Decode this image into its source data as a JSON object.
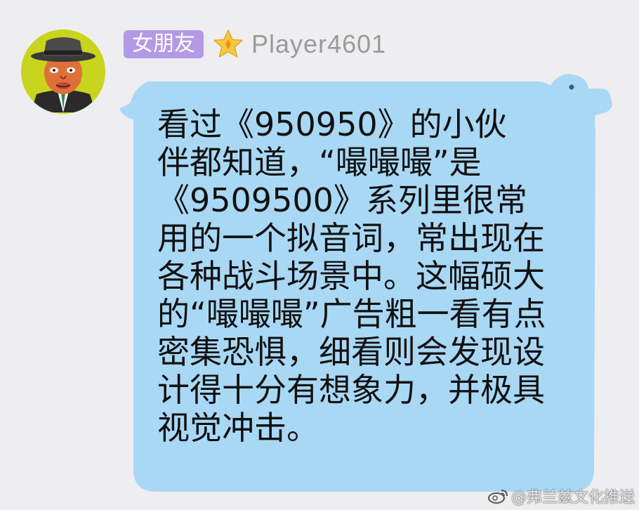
{
  "sender": {
    "tag": "女朋友",
    "name": "Player4601"
  },
  "message": {
    "text": "看过《950950》的小伙\n伴都知道，“嘬嘬嘬”是\n《9509500》系列里很常\n用的一个拟音词，常出现在\n各种战斗场景中。这幅硕大\n的“嘬嘬嘬”广告粗一看有点\n密集恐惧，细看则会发现设\n计得十分有想象力，并极具\n视觉冲击。"
  },
  "watermark": {
    "text": "@弗兰兹文化推送"
  },
  "icons": {
    "avatar": "avatar-cartoon-man-hat",
    "badge": "star-icon",
    "watermark": "weibo-icon"
  },
  "colors": {
    "background": "#eeeef0",
    "bubble": "#a9d8f5",
    "tag": "#b39ae6",
    "star": "#f4c842"
  }
}
